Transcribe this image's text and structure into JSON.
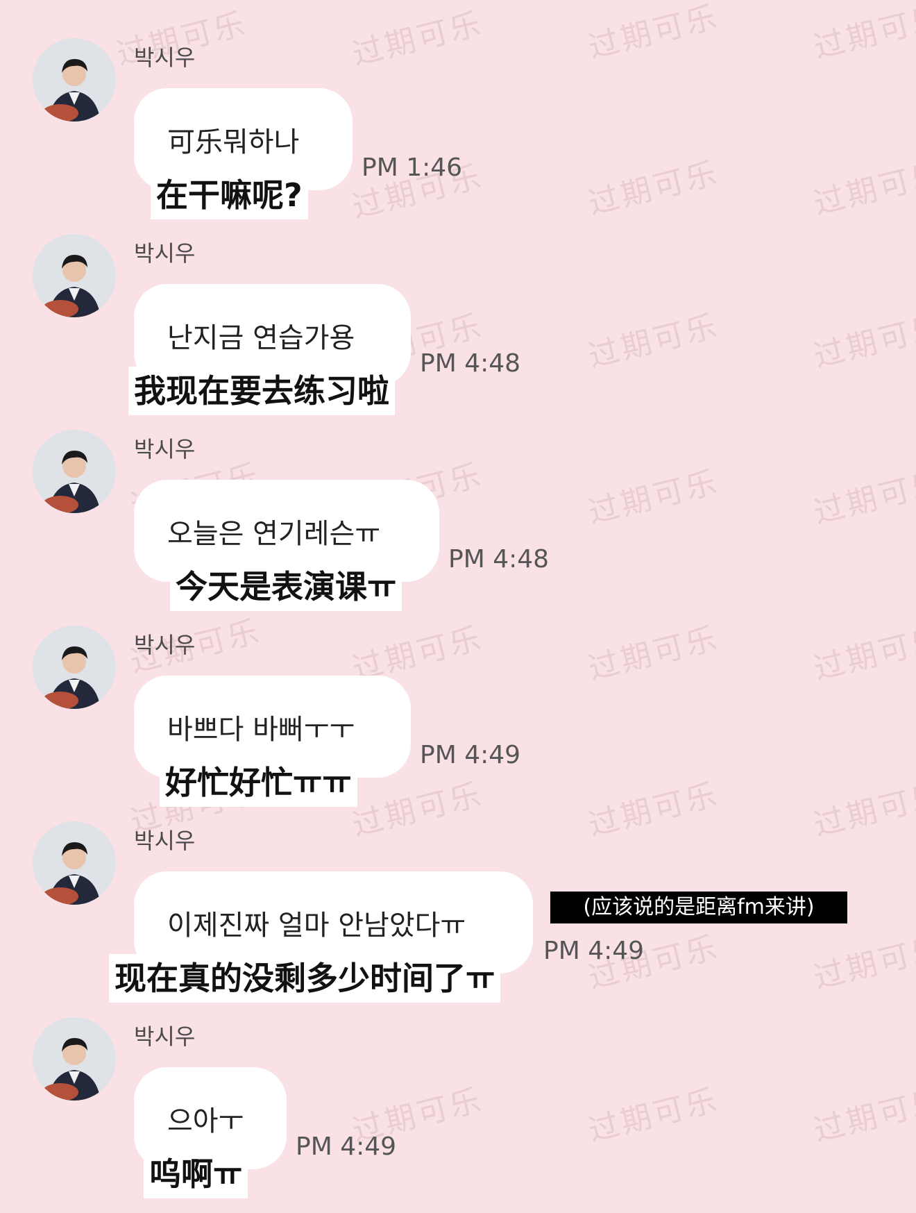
{
  "watermark_text": "过期可乐",
  "messages": [
    {
      "sender": "박시우",
      "korean": "可乐뭐하나",
      "chinese": "在干嘛呢?",
      "time": "PM 1:46"
    },
    {
      "sender": "박시우",
      "korean": "난지금 연습가용",
      "chinese": "我现在要去练习啦",
      "time": "PM 4:48"
    },
    {
      "sender": "박시우",
      "korean": "오늘은 연기레슨ㅠ",
      "chinese": "今天是表演课ㅠ",
      "time": "PM 4:48"
    },
    {
      "sender": "박시우",
      "korean": "바쁘다 바뻐ㅜㅜ",
      "chinese": "好忙好忙ㅠㅠ",
      "time": "PM 4:49"
    },
    {
      "sender": "박시우",
      "korean": "이제진짜 얼마 안남았다ㅠ",
      "chinese": "现在真的没剩多少时间了ㅠ",
      "time": "PM 4:49"
    },
    {
      "sender": "박시우",
      "korean": "으아ㅜ",
      "chinese": "呜啊ㅠ",
      "time": "PM 4:49"
    }
  ],
  "translator_note": "(应该说的是距离fm来讲)",
  "avatar_icon": "profile-photo-icon"
}
